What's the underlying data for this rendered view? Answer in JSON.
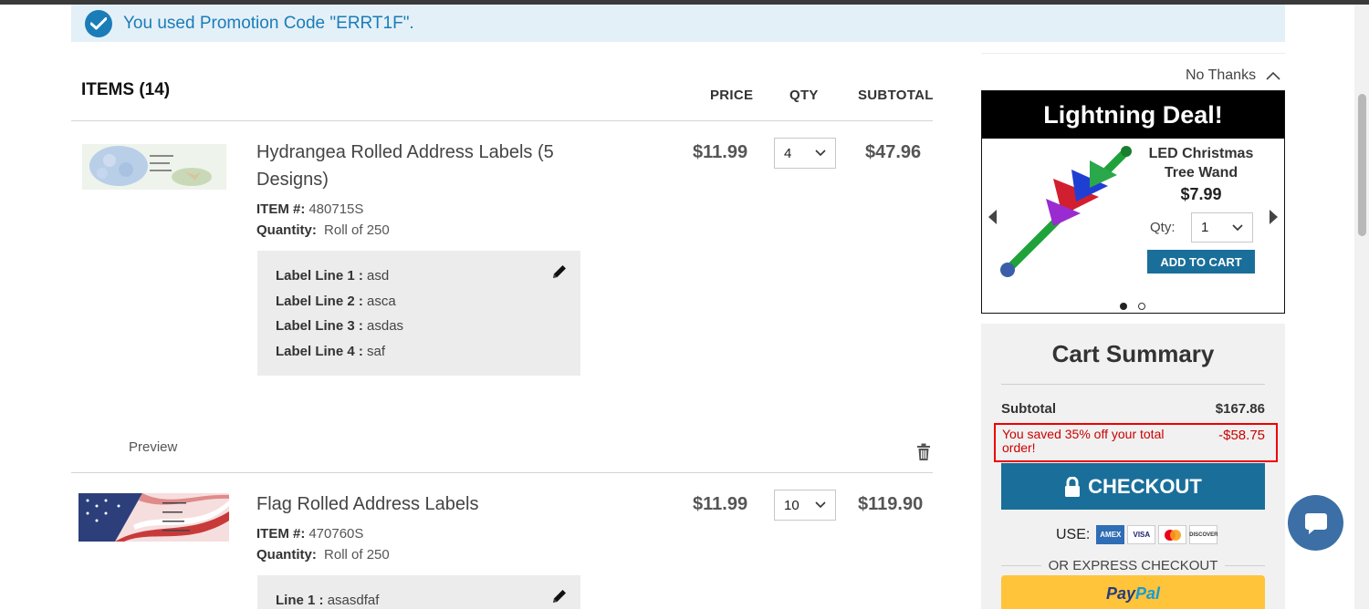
{
  "promo": {
    "message": "You used Promotion Code \"ERRT1F\"."
  },
  "items_header": {
    "title": "ITEMS (14)",
    "price": "PRICE",
    "qty": "QTY",
    "subtotal": "SUBTOTAL"
  },
  "items": [
    {
      "name_line1": "Hydrangea Rolled Address Labels (5",
      "name_line2": "Designs)",
      "item_no_label": "ITEM #:",
      "item_no": "480715S",
      "quantity_label": "Quantity:",
      "quantity": "Roll of 250",
      "price": "$11.99",
      "qty": "4",
      "subtotal": "$47.96",
      "label_lines": [
        {
          "label": "Label Line 1 :",
          "value": "asd"
        },
        {
          "label": "Label Line 2 :",
          "value": "asca"
        },
        {
          "label": "Label Line 3 :",
          "value": "asdas"
        },
        {
          "label": "Label Line 4 :",
          "value": "saf"
        }
      ],
      "preview": "Preview"
    },
    {
      "name_line1": "Flag Rolled Address Labels",
      "item_no_label": "ITEM #:",
      "item_no": "470760S",
      "quantity_label": "Quantity:",
      "quantity": "Roll of 250",
      "price": "$11.99",
      "qty": "10",
      "subtotal": "$119.90",
      "label_lines": [
        {
          "label": "Line 1 :",
          "value": "asasdfaf"
        }
      ]
    }
  ],
  "deal": {
    "no_thanks": "No Thanks",
    "title": "Lightning Deal!",
    "name_line1": "LED Christmas",
    "name_line2": "Tree Wand",
    "price": "$7.99",
    "qty_label": "Qty:",
    "qty": "1",
    "add_to_cart": "ADD TO CART"
  },
  "summary": {
    "title": "Cart Summary",
    "subtotal_label": "Subtotal",
    "subtotal_value": "$167.86",
    "saved_label": "You saved 35% off your total order!",
    "saved_value": "-$58.75",
    "checkout": "CHECKOUT",
    "use_label": "USE:",
    "cards": [
      "AMEX",
      "VISA",
      "MC",
      "DISCOVER"
    ],
    "express": "OR EXPRESS CHECKOUT",
    "paypal_1": "Pay",
    "paypal_2": "Pal"
  },
  "colors": {
    "accent": "#1a6f9a",
    "promo_text": "#1a7db8",
    "promo_bg": "#e4f0f8",
    "saved_red": "#cc0000"
  }
}
